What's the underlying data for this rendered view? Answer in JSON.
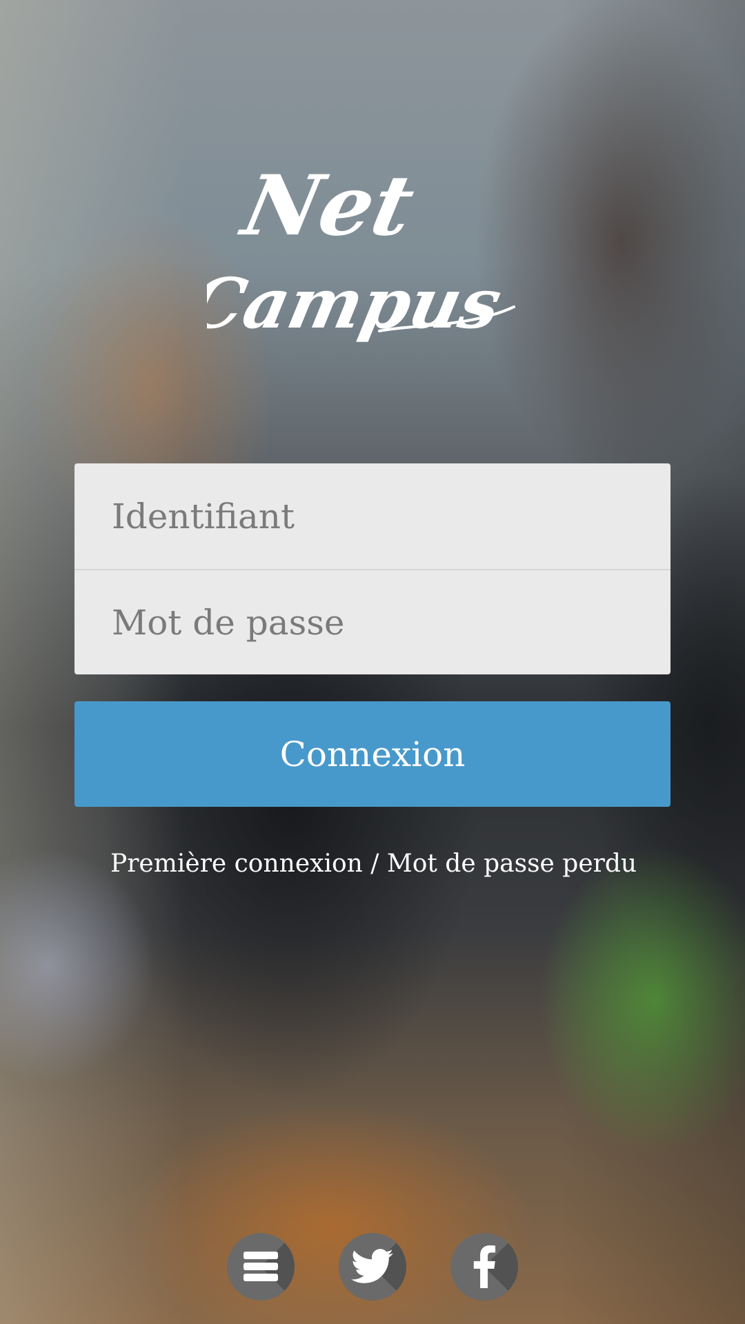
{
  "app": {
    "logo_text": "Net Campus"
  },
  "login": {
    "username_placeholder": "Identifiant",
    "password_placeholder": "Mot de passe",
    "submit_label": "Connexion"
  },
  "links": {
    "first_login": "Première connexion",
    "separator": " / ",
    "forgot_password": "Mot de passe perdu"
  },
  "social": {
    "items": [
      {
        "icon": "menu-icon"
      },
      {
        "icon": "twitter-icon"
      },
      {
        "icon": "facebook-icon"
      }
    ]
  },
  "colors": {
    "accent": "#4899cb",
    "form_bg": "#eaeaea",
    "placeholder": "#7a7a7a",
    "social_bg": "#6a6a6a"
  }
}
